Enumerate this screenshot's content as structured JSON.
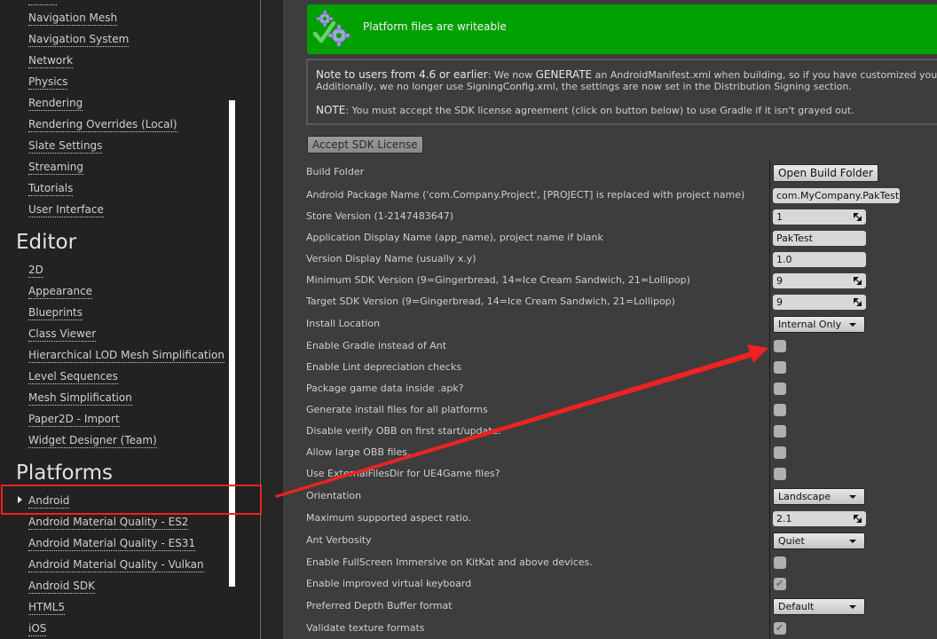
{
  "sidebar": {
    "top_items": [
      "Navigation Mesh",
      "Navigation System",
      "Network",
      "Physics",
      "Rendering",
      "Rendering Overrides (Local)",
      "Slate Settings",
      "Streaming",
      "Tutorials",
      "User Interface"
    ],
    "editor_heading": "Editor",
    "editor_items": [
      "2D",
      "Appearance",
      "Blueprints",
      "Class Viewer",
      "Hierarchical LOD Mesh Simplification",
      "Level Sequences",
      "Mesh Simplification",
      "Paper2D - Import",
      "Widget Designer (Team)"
    ],
    "platforms_heading": "Platforms",
    "platforms_items": [
      "Android",
      "Android Material Quality - ES2",
      "Android Material Quality - ES31",
      "Android Material Quality - Vulkan",
      "Android SDK",
      "HTML5",
      "iOS"
    ],
    "selected": "Android"
  },
  "banner": {
    "text": "Platform files are writeable",
    "color": "#00a000"
  },
  "note": {
    "line1_em": "Note to users from 4.6 or earlier",
    "line1_a": ": We now ",
    "line1_em2": "GENERATE",
    "line1_b": " an AndroidManifest.xml when building, so if you have customized your .xml file, you",
    "line2": "Additionally, we no longer use SigningConfig.xml, the settings are now set in the Distribution Signing section.",
    "line3_em": "NOTE",
    "line3": ": You must accept the SDK license agreement (click on button below) to use Gradle if it isn't grayed out."
  },
  "accept_button": "Accept SDK License",
  "settings": {
    "build_folder": {
      "label": "Build Folder",
      "button": "Open Build Folder"
    },
    "package_name": {
      "label": "Android Package Name ('com.Company.Project', [PROJECT] is replaced with project name)",
      "value": "com.MyCompany.PakTest"
    },
    "store_version": {
      "label": "Store Version (1-2147483647)",
      "value": "1"
    },
    "app_display_name": {
      "label": "Application Display Name (app_name), project name if blank",
      "value": "PakTest"
    },
    "version_display_name": {
      "label": "Version Display Name (usually x.y)",
      "value": "1.0"
    },
    "min_sdk": {
      "label": "Minimum SDK Version (9=Gingerbread, 14=Ice Cream Sandwich, 21=Lollipop)",
      "value": "9"
    },
    "target_sdk": {
      "label": "Target SDK Version (9=Gingerbread, 14=Ice Cream Sandwich, 21=Lollipop)",
      "value": "9"
    },
    "install_location": {
      "label": "Install Location",
      "value": "Internal Only"
    },
    "enable_gradle": {
      "label": "Enable Gradle instead of Ant",
      "checked": false
    },
    "enable_lint": {
      "label": "Enable Lint depreciation checks",
      "checked": false
    },
    "package_in_apk": {
      "label": "Package game data inside .apk?",
      "checked": false
    },
    "generate_install_files": {
      "label": "Generate install files for all platforms",
      "checked": false
    },
    "disable_verify_obb": {
      "label": "Disable verify OBB on first start/update.",
      "checked": false
    },
    "allow_large_obb": {
      "label": "Allow large OBB files.",
      "checked": false
    },
    "use_external_files_dir": {
      "label": "Use ExternalFilesDir for UE4Game files?",
      "checked": false
    },
    "orientation": {
      "label": "Orientation",
      "value": "Landscape"
    },
    "max_aspect_ratio": {
      "label": "Maximum supported aspect ratio.",
      "value": "2.1"
    },
    "ant_verbosity": {
      "label": "Ant Verbosity",
      "value": "Quiet"
    },
    "fullscreen_immersive": {
      "label": "Enable FullScreen Immersive on KitKat and above devices.",
      "checked": false
    },
    "improved_keyboard": {
      "label": "Enable improved virtual keyboard",
      "checked": true
    },
    "depth_buffer": {
      "label": "Preferred Depth Buffer format",
      "value": "Default"
    },
    "validate_texture": {
      "label": "Validate texture formats",
      "checked": true
    }
  },
  "annotation": {
    "color": "#ee2222"
  },
  "check_glyph": "✔"
}
